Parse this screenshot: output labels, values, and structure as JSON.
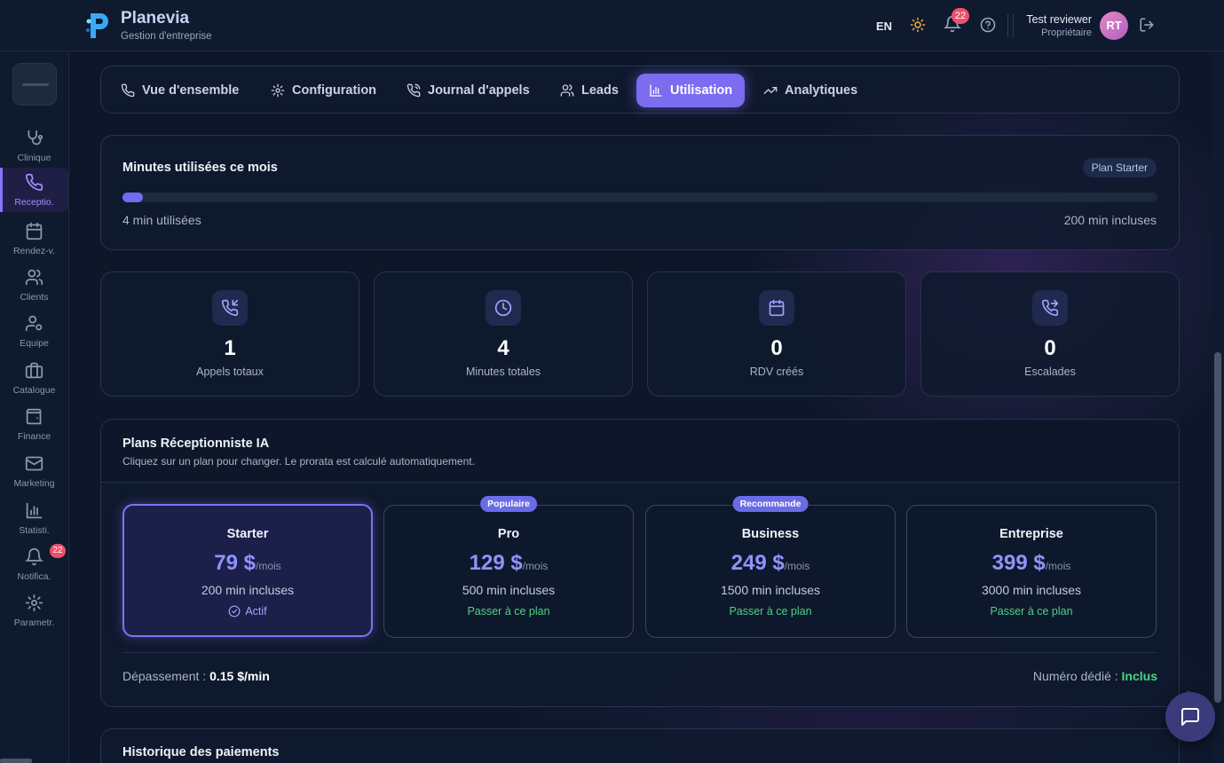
{
  "brand": {
    "name": "Planevia",
    "subtitle": "Gestion d'entreprise"
  },
  "header": {
    "language": "EN",
    "notifications_count": "22",
    "user_name": "Test reviewer",
    "user_role": "Propriétaire",
    "avatar_initials": "RT"
  },
  "sidebar": {
    "items": [
      {
        "label": "Clinique",
        "icon": "stethoscope-icon"
      },
      {
        "label": "Receptio.",
        "icon": "phone-icon"
      },
      {
        "label": "Rendez-v.",
        "icon": "calendar-icon"
      },
      {
        "label": "Clients",
        "icon": "users-icon"
      },
      {
        "label": "Equipe",
        "icon": "user-gear-icon"
      },
      {
        "label": "Catalogue",
        "icon": "briefcase-icon"
      },
      {
        "label": "Finance",
        "icon": "wallet-icon"
      },
      {
        "label": "Marketing",
        "icon": "mail-icon"
      },
      {
        "label": "Statisti.",
        "icon": "bar-chart-icon"
      },
      {
        "label": "Notifica.",
        "icon": "bell-icon",
        "badge": "22"
      },
      {
        "label": "Parametr.",
        "icon": "gear-icon"
      }
    ]
  },
  "tabs": [
    {
      "label": "Vue d'ensemble",
      "icon": "phone-icon"
    },
    {
      "label": "Configuration",
      "icon": "gear-icon"
    },
    {
      "label": "Journal d'appels",
      "icon": "phone-call-icon"
    },
    {
      "label": "Leads",
      "icon": "users-icon"
    },
    {
      "label": "Utilisation",
      "icon": "bar-chart-icon",
      "active": true
    },
    {
      "label": "Analytiques",
      "icon": "trending-up-icon"
    }
  ],
  "usage": {
    "title": "Minutes utilisées ce mois",
    "plan_badge": "Plan Starter",
    "used_label": "4 min utilisées",
    "included_label": "200 min incluses",
    "used_minutes": 4,
    "included_minutes": 200
  },
  "stats": [
    {
      "value": "1",
      "label": "Appels totaux",
      "icon": "phone-incoming-icon"
    },
    {
      "value": "4",
      "label": "Minutes totales",
      "icon": "clock-icon"
    },
    {
      "value": "0",
      "label": "RDV créés",
      "icon": "calendar-icon"
    },
    {
      "value": "0",
      "label": "Escalades",
      "icon": "phone-forward-icon"
    }
  ],
  "plans": {
    "title": "Plans Réceptionniste IA",
    "subtitle": "Cliquez sur un plan pour changer. Le prorata est calculé automatiquement.",
    "items": [
      {
        "name": "Starter",
        "price": "79 $",
        "period": "/mois",
        "minutes": "200 min incluses",
        "action": "Actif",
        "active": true,
        "tag": ""
      },
      {
        "name": "Pro",
        "price": "129 $",
        "period": "/mois",
        "minutes": "500 min incluses",
        "action": "Passer à ce plan",
        "tag": "Populaire"
      },
      {
        "name": "Business",
        "price": "249 $",
        "period": "/mois",
        "minutes": "1500 min incluses",
        "action": "Passer à ce plan",
        "tag": "Recommande"
      },
      {
        "name": "Entreprise",
        "price": "399 $",
        "period": "/mois",
        "minutes": "3000 min incluses",
        "action": "Passer à ce plan",
        "tag": ""
      }
    ],
    "overage_label": "Dépassement : ",
    "overage_value": "0.15 $/min",
    "dedicated_label": "Numéro dédié : ",
    "dedicated_value": "Inclus"
  },
  "history": {
    "title": "Historique des paiements"
  },
  "colors": {
    "accent": "#7c6cf0",
    "price": "#8f94ff",
    "success": "#4bd47e",
    "badge": "#ef4f6a",
    "background": "#0d1729"
  }
}
